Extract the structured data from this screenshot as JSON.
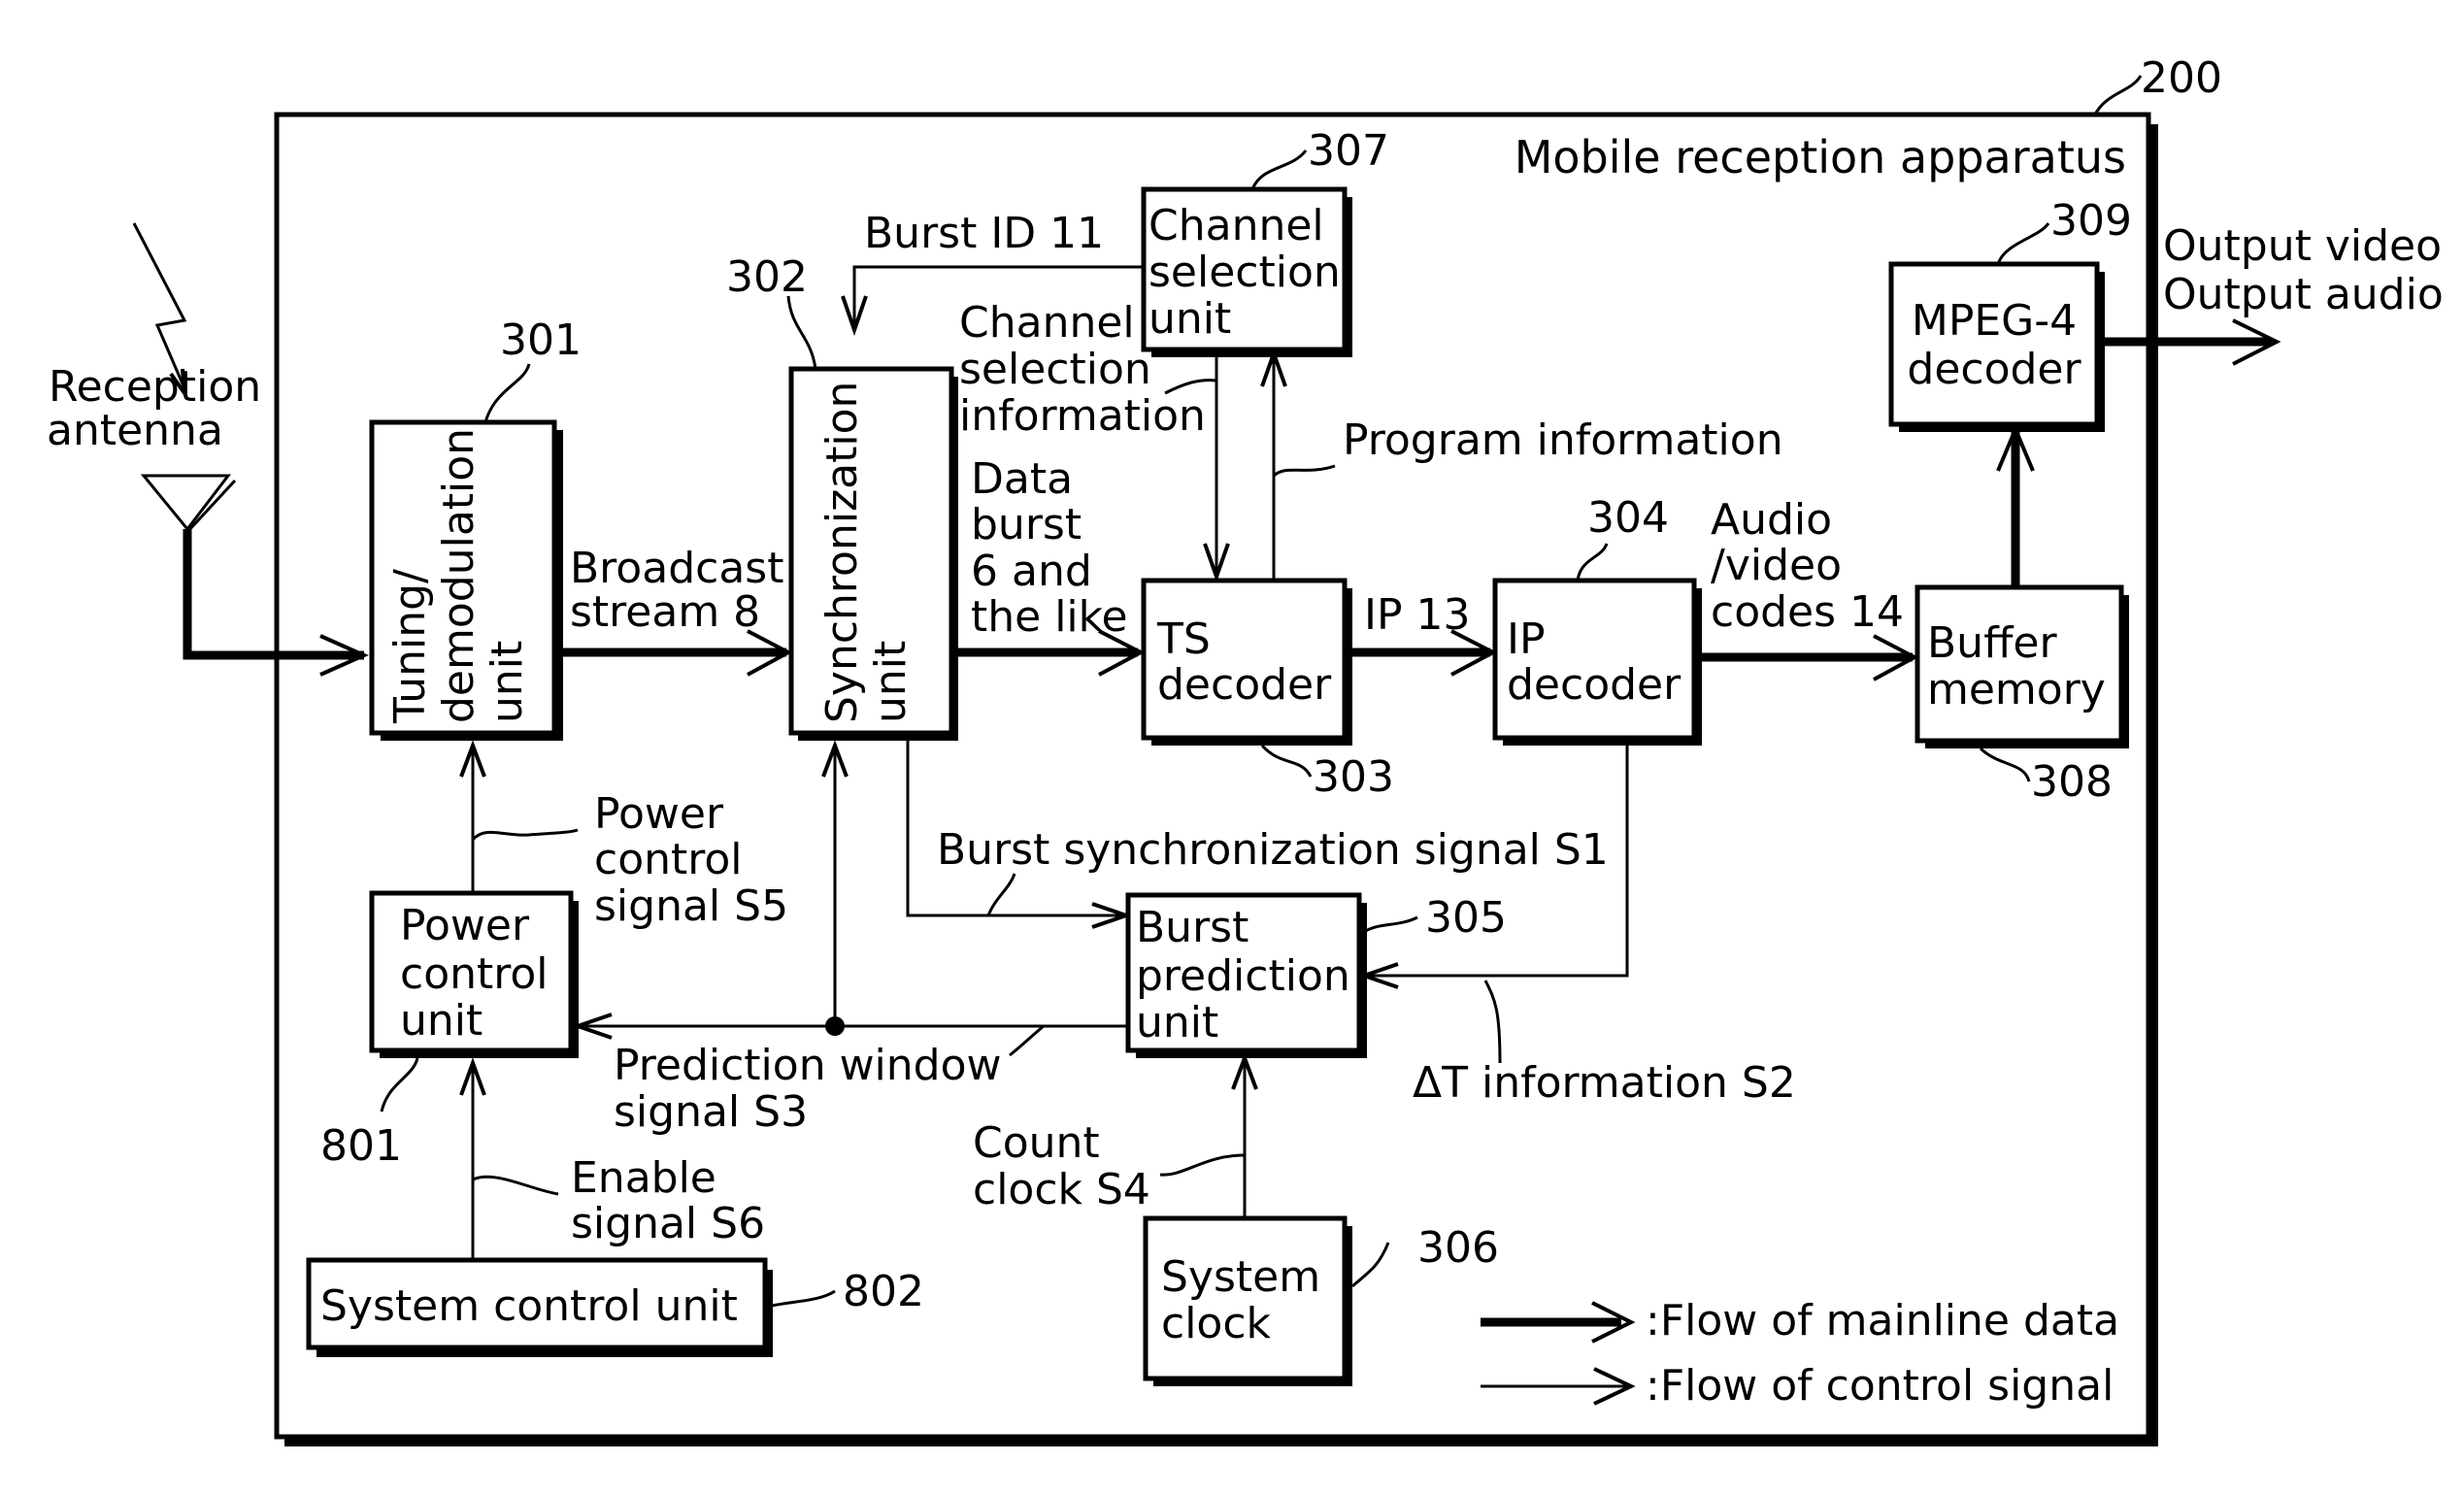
{
  "diagram": {
    "apparatus": {
      "title": "Mobile reception apparatus",
      "ref": "200"
    },
    "antenna": {
      "label_line1": "Reception",
      "label_line2": "antenna"
    },
    "blocks": {
      "tuning": {
        "lines": [
          "Tuning/",
          "demodulation",
          "unit"
        ],
        "ref": "301"
      },
      "sync": {
        "lines": [
          "Synchronization",
          "unit"
        ],
        "ref": "302"
      },
      "ts_decoder": {
        "lines": [
          "TS",
          "decoder"
        ],
        "ref": "303"
      },
      "ip_decoder": {
        "lines": [
          "IP",
          "decoder"
        ],
        "ref": "304"
      },
      "burst_prediction": {
        "lines": [
          "Burst",
          "prediction",
          "unit"
        ],
        "ref": "305"
      },
      "system_clock": {
        "lines": [
          "System",
          "clock"
        ],
        "ref": "306"
      },
      "channel_selection": {
        "lines": [
          "Channel",
          "selection",
          "unit"
        ],
        "ref": "307"
      },
      "buffer_memory": {
        "lines": [
          "Buffer",
          "memory"
        ],
        "ref": "308"
      },
      "mpeg4_decoder": {
        "lines": [
          "MPEG-4",
          "decoder"
        ],
        "ref": "309"
      },
      "power_control": {
        "lines": [
          "Power",
          "control",
          "unit"
        ],
        "ref": "801"
      },
      "system_control": {
        "lines": [
          "System control unit"
        ],
        "ref": "802"
      }
    },
    "signals": {
      "broadcast_stream": [
        "Broadcast",
        "stream 8"
      ],
      "data_burst": [
        "Data",
        "burst",
        "6 and",
        "the like"
      ],
      "ip13": [
        "IP 13"
      ],
      "av_codes": [
        "Audio",
        "/video",
        "codes 14"
      ],
      "output": [
        "Output video",
        "Output audio"
      ],
      "burst_id": [
        "Burst ID 11"
      ],
      "channel_sel_info": [
        "Channel",
        "selection",
        "information"
      ],
      "program_info": [
        "Program information"
      ],
      "burst_sync_s1": [
        "Burst synchronization signal S1"
      ],
      "delta_t_s2": [
        "ΔT information S2"
      ],
      "prediction_window_s3": [
        "Prediction window",
        "signal S3"
      ],
      "count_clock_s4": [
        "Count",
        "clock S4"
      ],
      "power_control_s5": [
        "Power",
        "control",
        "signal S5"
      ],
      "enable_s6": [
        "Enable",
        "signal S6"
      ]
    },
    "legend": {
      "mainline": ":Flow of mainline data",
      "control": ":Flow of control signal"
    }
  }
}
